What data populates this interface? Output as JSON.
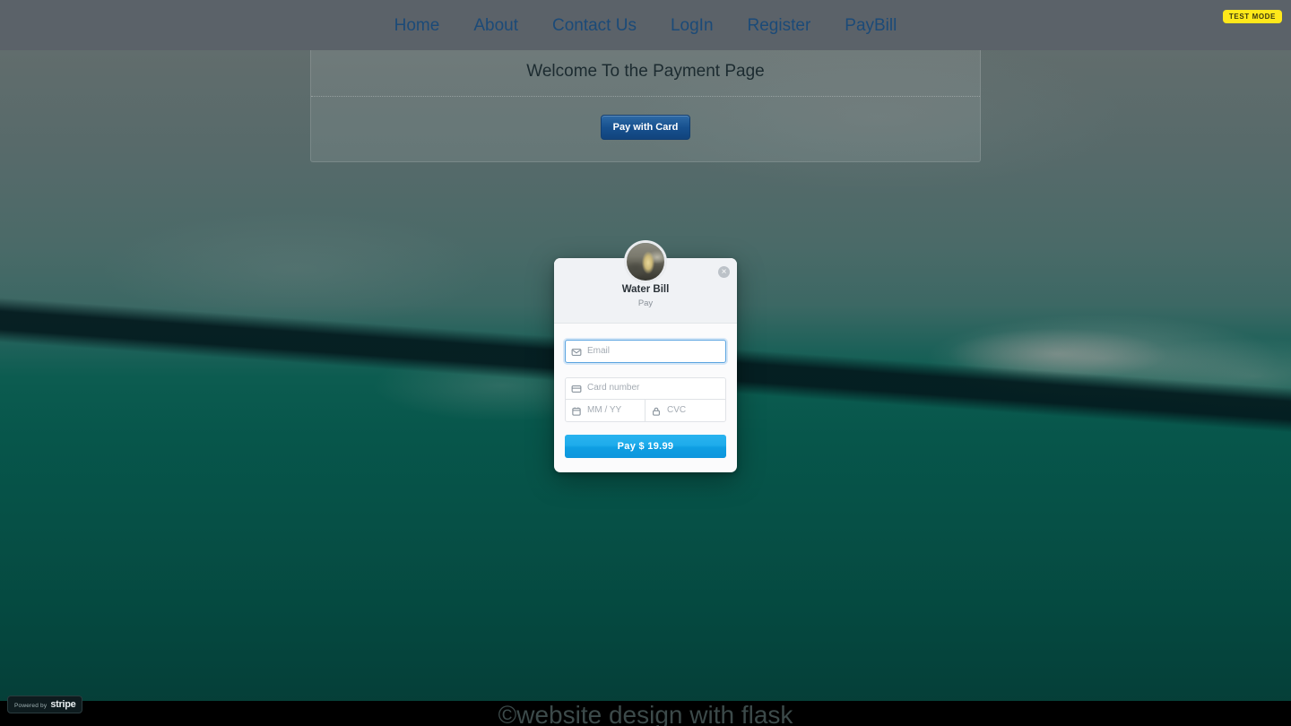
{
  "navbar": {
    "links": [
      {
        "label": "Home",
        "name": "nav-link-home"
      },
      {
        "label": "About",
        "name": "nav-link-about"
      },
      {
        "label": "Contact Us",
        "name": "nav-link-contact-us"
      },
      {
        "label": "LogIn",
        "name": "nav-link-login"
      },
      {
        "label": "Register",
        "name": "nav-link-register"
      },
      {
        "label": "PayBill",
        "name": "nav-link-paybill"
      }
    ],
    "test_mode_badge": "TEST MODE",
    "link_color": "#1b4a78",
    "background_color": "#5b6269",
    "badge_background": "#ffe81a"
  },
  "welcome_panel": {
    "heading": "Welcome To the Payment Page",
    "pay_with_card_label": "Pay with Card",
    "button_color": "#17518f"
  },
  "checkout_modal": {
    "avatar_icon": "merchant-avatar-photo",
    "close_icon": "close-icon",
    "close_glyph": "×",
    "merchant_name": "Water Bill",
    "merchant_description": "Pay",
    "fields": {
      "email": {
        "placeholder": "Email",
        "value": "",
        "icon": "envelope-icon"
      },
      "card_number": {
        "placeholder": "Card number",
        "value": "",
        "icon": "credit-card-icon"
      },
      "expiry": {
        "placeholder": "MM / YY",
        "value": "",
        "icon": "calendar-icon"
      },
      "cvc": {
        "placeholder": "CVC",
        "value": "",
        "icon": "lock-icon"
      }
    },
    "submit_label": "Pay $ 19.99",
    "submit_color": "#0e9ee2",
    "focused_field": "email"
  },
  "powered_by": {
    "prefix": "Powered by",
    "wordmark": "stripe"
  },
  "footer": {
    "text": "©website design with flask"
  }
}
